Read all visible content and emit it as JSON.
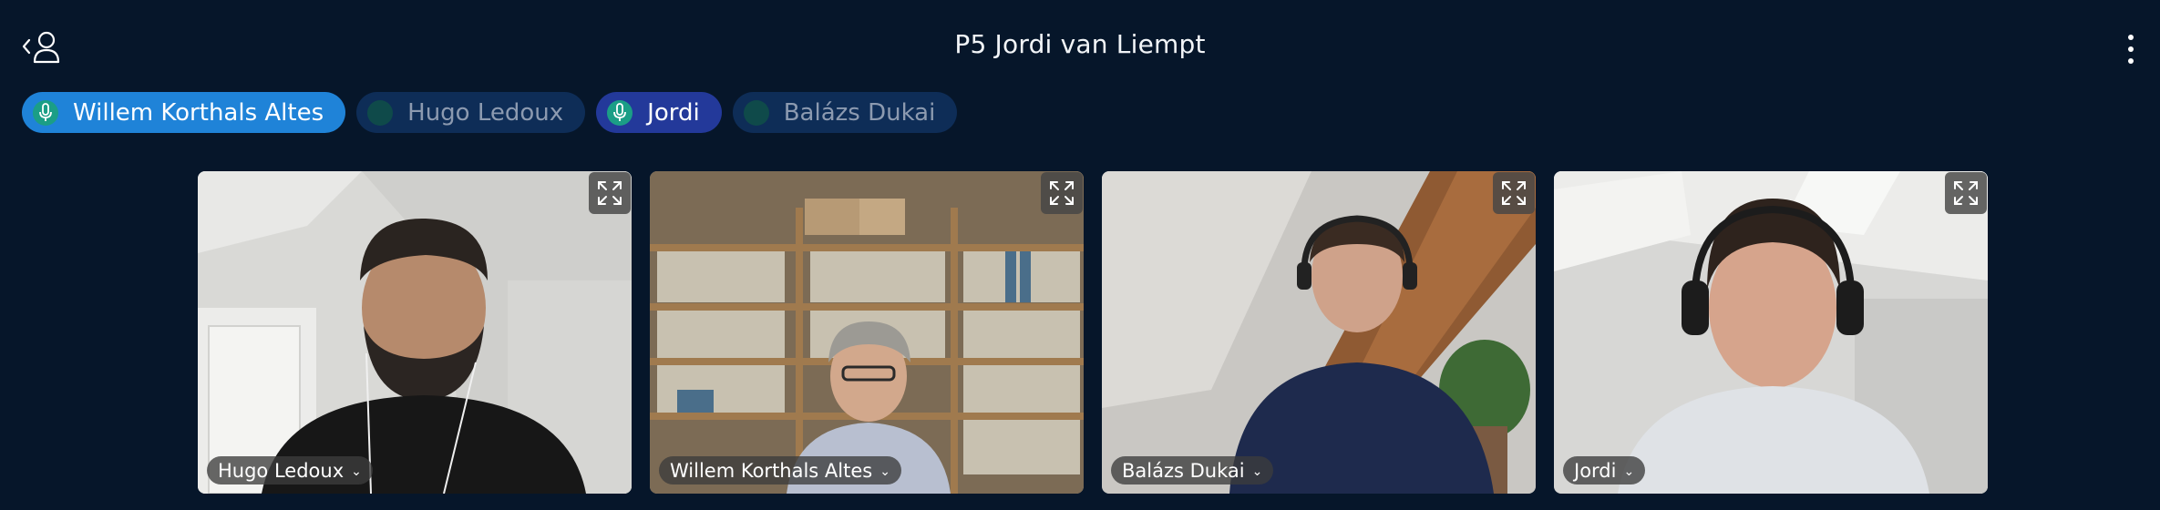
{
  "header": {
    "title": "P5 Jordi van Liempt"
  },
  "icons": {
    "back": "back-person-icon",
    "menu": "kebab-menu-icon",
    "mic": "microphone-icon",
    "expand": "expand-icon",
    "chevron": "chevron-down-icon"
  },
  "pills": [
    {
      "name": "Willem Korthals Altes",
      "state": "speaking",
      "bg": "#1f83d8",
      "text": "#ffffff",
      "dot": "#1b9e86"
    },
    {
      "name": "Hugo Ledoux",
      "state": "muted",
      "bg": "#0e2d57",
      "text": "#8c9ab0",
      "dot": "#0f4a4a"
    },
    {
      "name": "Jordi",
      "state": "speaking",
      "bg": "#23399a",
      "text": "#ffffff",
      "dot": "#1b9e86"
    },
    {
      "name": "Balázs Dukai",
      "state": "muted",
      "bg": "#0e2d57",
      "text": "#8c9ab0",
      "dot": "#0f4a4a"
    }
  ],
  "tiles": [
    {
      "name": "Hugo Ledoux"
    },
    {
      "name": "Willem Korthals Altes"
    },
    {
      "name": "Balázs Dukai"
    },
    {
      "name": "Jordi"
    }
  ],
  "colors": {
    "background": "#06162a",
    "speaking_indicator": "#1b9e86"
  }
}
